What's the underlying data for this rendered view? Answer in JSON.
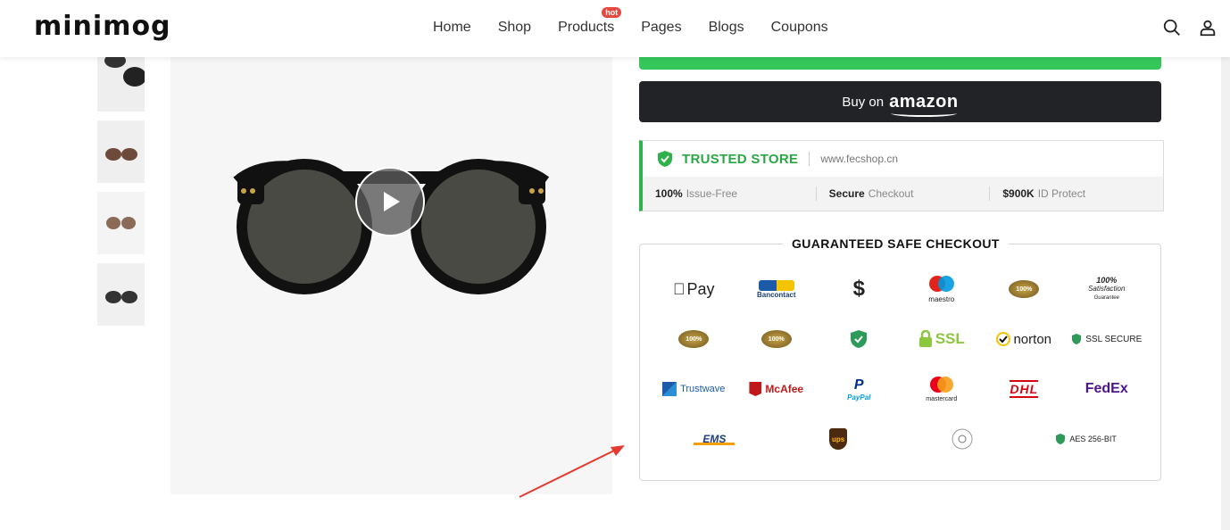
{
  "header": {
    "logo": "minimog",
    "nav": [
      {
        "label": "Home"
      },
      {
        "label": "Shop"
      },
      {
        "label": "Products",
        "badge": "hot"
      },
      {
        "label": "Pages"
      },
      {
        "label": "Blogs"
      },
      {
        "label": "Coupons"
      }
    ],
    "icons": [
      "search-icon",
      "user-icon"
    ]
  },
  "gallery": {
    "thumbnails": [
      "sunglasses-thumb-1",
      "sunglasses-thumb-2",
      "sunglasses-thumb-3",
      "sunglasses-thumb-4"
    ],
    "main_icon": "play-icon"
  },
  "buy_button": {
    "prefix": "Buy on",
    "brand": "amazon"
  },
  "trusted": {
    "title": "TRUSTED STORE",
    "url": "www.fecshop.cn",
    "stats": [
      {
        "value": "100%",
        "label": "Issue-Free"
      },
      {
        "value": "Secure",
        "label": "Checkout"
      },
      {
        "value": "$900K",
        "label": "ID Protect"
      }
    ]
  },
  "checkout": {
    "title": "GUARANTEED SAFE CHECKOUT",
    "row1": [
      "Pay",
      "Bancontact",
      "$",
      "maestro",
      "100%",
      "100%"
    ],
    "row1_sub": "Satisfaction",
    "row1_sub2": "Guarantee",
    "row2": [
      "100%",
      "100%",
      "",
      "SSL",
      "norton",
      "SSL SECURE"
    ],
    "row3": [
      "Trustwave",
      "McAfee",
      "PayPal",
      "mastercard",
      "DHL",
      "FedEx"
    ],
    "row4": [
      "EMS",
      "ups",
      "",
      "AES 256-BIT"
    ]
  },
  "colors": {
    "accent_green": "#2fb24c",
    "button_dark": "#222326",
    "hot_badge": "#e5483f",
    "arrow": "#e53a2f"
  }
}
